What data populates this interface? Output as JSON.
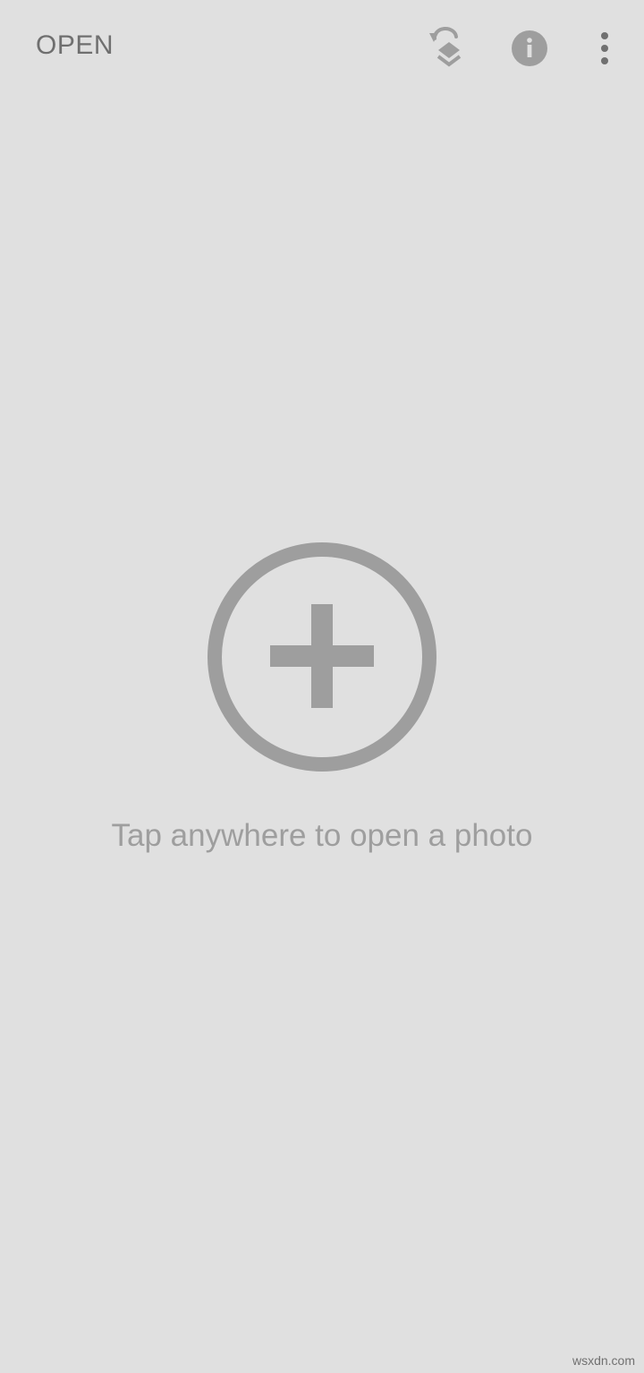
{
  "toolbar": {
    "open_label": "OPEN",
    "icons": [
      "stack-revert-icon",
      "info-icon",
      "more-vert-icon"
    ],
    "info_letter": "i"
  },
  "main": {
    "prompt": "Tap anywhere to open a photo",
    "add_icon": "add-circle-icon"
  },
  "watermark": "wsxdn.com",
  "colors": {
    "background": "#e0e0e0",
    "icon_gray": "#9e9e9e",
    "text_dark": "#6f6f6f",
    "text_light": "#9e9e9e"
  }
}
